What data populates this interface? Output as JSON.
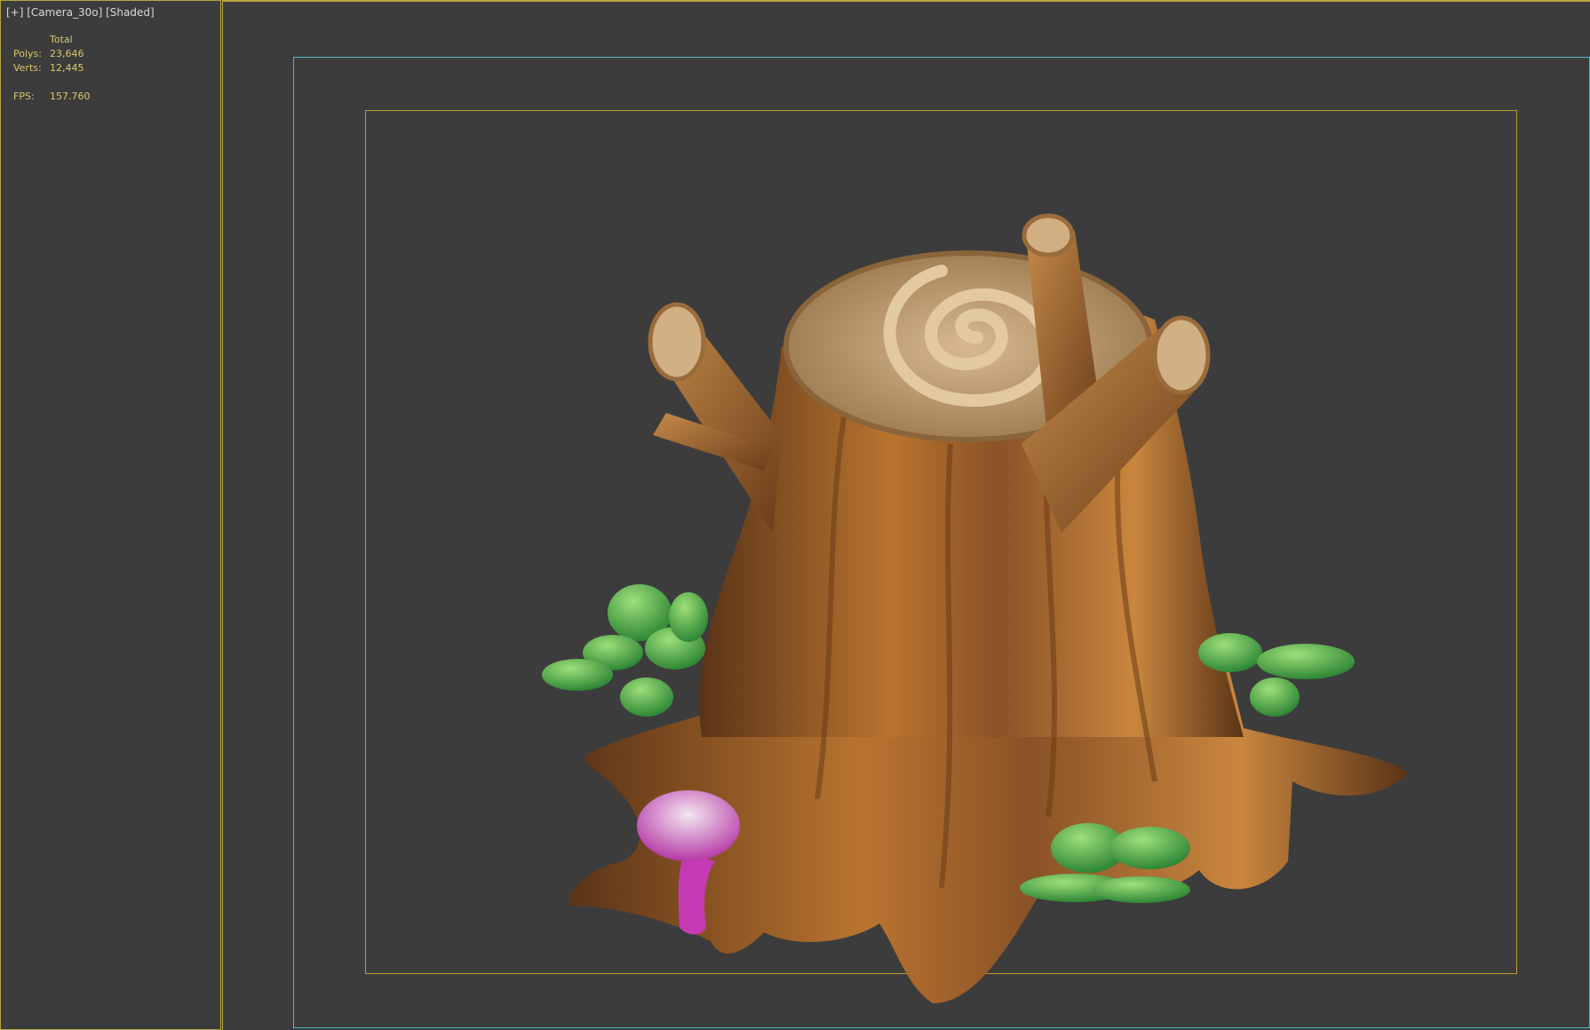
{
  "viewport": {
    "label": "[+] [Camera_30o] [Shaded]"
  },
  "stats": {
    "header": "Total",
    "polys_label": "Polys:",
    "polys_value": "23,646",
    "verts_label": "Verts:",
    "verts_value": "12,445",
    "fps_label": "FPS:",
    "fps_value": "157.760"
  },
  "colors": {
    "frame_border": "#b9a63f",
    "safe_frame": "#4fb6c7",
    "title_safe": "#c09a2f",
    "stats_text": "#d9c86b",
    "background": "#3c3c3c"
  }
}
